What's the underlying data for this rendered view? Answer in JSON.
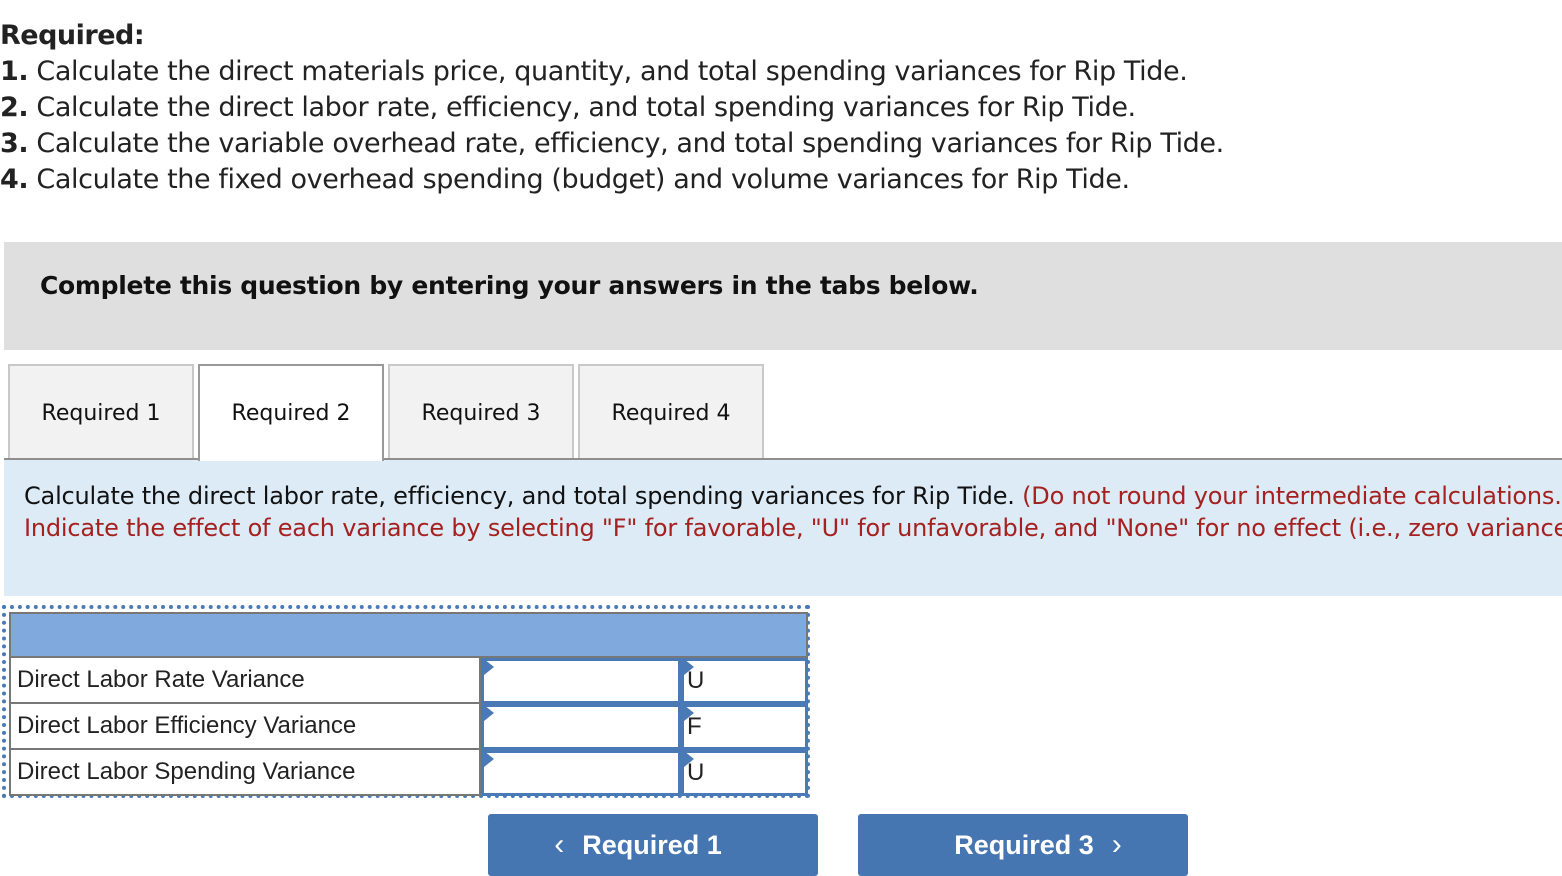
{
  "required": {
    "title": "Required:",
    "items": [
      {
        "num": "1.",
        "text": " Calculate the direct materials price, quantity, and total spending variances for Rip Tide."
      },
      {
        "num": "2.",
        "text": " Calculate the direct labor rate, efficiency, and total spending variances for Rip Tide."
      },
      {
        "num": "3.",
        "text": " Calculate the variable overhead rate, efficiency, and total spending variances for Rip Tide."
      },
      {
        "num": "4.",
        "text": " Calculate the fixed overhead spending (budget) and volume variances for Rip Tide."
      }
    ]
  },
  "instructions": "Complete this question by entering your answers in the tabs below.",
  "tabs": [
    {
      "label": "Required 1",
      "active": false
    },
    {
      "label": "Required 2",
      "active": true
    },
    {
      "label": "Required 3",
      "active": false
    },
    {
      "label": "Required 4",
      "active": false
    }
  ],
  "prompt": {
    "main": "Calculate the direct labor rate, efficiency, and total spending variances for Rip Tide. ",
    "note": "(Do not round your intermediate calculations. Indicate the effect of each variance by selecting \"F\" for favorable, \"U\" for unfavorable, and \"None\" for no effect (i.e., zero variance).)"
  },
  "table": {
    "rows": [
      {
        "label": "Direct Labor Rate Variance",
        "value": "",
        "effect": "U"
      },
      {
        "label": "Direct Labor Efficiency Variance",
        "value": "",
        "effect": "F"
      },
      {
        "label": "Direct Labor Spending Variance",
        "value": "",
        "effect": "U"
      }
    ]
  },
  "nav": {
    "prev_label": "Required 1",
    "next_label": "Required 3",
    "prev_icon": "chevron-left-icon",
    "next_icon": "chevron-right-icon",
    "prev_glyph": "‹",
    "next_glyph": "›"
  },
  "colors": {
    "accent": "#4676b2",
    "note_red": "#a5211f",
    "table_header": "#80a9dd",
    "prompt_bg": "#ddebf7"
  }
}
